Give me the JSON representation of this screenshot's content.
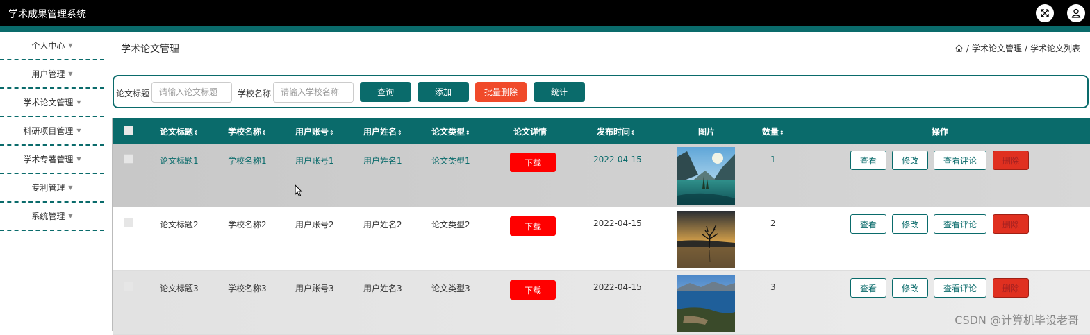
{
  "app": {
    "title": "学术成果管理系统"
  },
  "sidebar": {
    "items": [
      {
        "label": "个人中心"
      },
      {
        "label": "用户管理"
      },
      {
        "label": "学术论文管理"
      },
      {
        "label": "科研项目管理"
      },
      {
        "label": "学术专著管理"
      },
      {
        "label": "专利管理"
      },
      {
        "label": "系统管理"
      }
    ]
  },
  "page": {
    "title": "学术论文管理",
    "breadcrumb": [
      "学术论文管理",
      "学术论文列表"
    ],
    "breadcrumb_sep": "/"
  },
  "search": {
    "title_label": "论文标题",
    "title_placeholder": "请输入论文标题",
    "school_label": "学校名称",
    "school_placeholder": "请输入学校名称",
    "query_label": "查询",
    "add_label": "添加",
    "batch_delete_label": "批量删除",
    "stats_label": "统计"
  },
  "table": {
    "headers": {
      "title": "论文标题",
      "school": "学校名称",
      "account": "用户账号",
      "name": "用户姓名",
      "type": "论文类型",
      "detail": "论文详情",
      "date": "发布时间",
      "image": "图片",
      "count": "数量",
      "ops": "操作"
    },
    "sort_glyph": "⇕",
    "rows": [
      {
        "title": "论文标题1",
        "school": "学校名称1",
        "account": "用户账号1",
        "name": "用户姓名1",
        "type": "论文类型1",
        "download": "下载",
        "date": "2022-04-15",
        "count": "1"
      },
      {
        "title": "论文标题2",
        "school": "学校名称2",
        "account": "用户账号2",
        "name": "用户姓名2",
        "type": "论文类型2",
        "download": "下载",
        "date": "2022-04-15",
        "count": "2"
      },
      {
        "title": "论文标题3",
        "school": "学校名称3",
        "account": "用户账号3",
        "name": "用户姓名3",
        "type": "论文类型3",
        "download": "下载",
        "date": "2022-04-15",
        "count": "3"
      }
    ],
    "ops": {
      "view": "查看",
      "edit": "修改",
      "comments": "查看评论",
      "delete": "删除"
    }
  },
  "watermark": "CSDN @计算机毕设老哥",
  "colors": {
    "accent": "#0a6b6b",
    "danger": "#ff0000",
    "batch_delete": "#f04a2a"
  }
}
